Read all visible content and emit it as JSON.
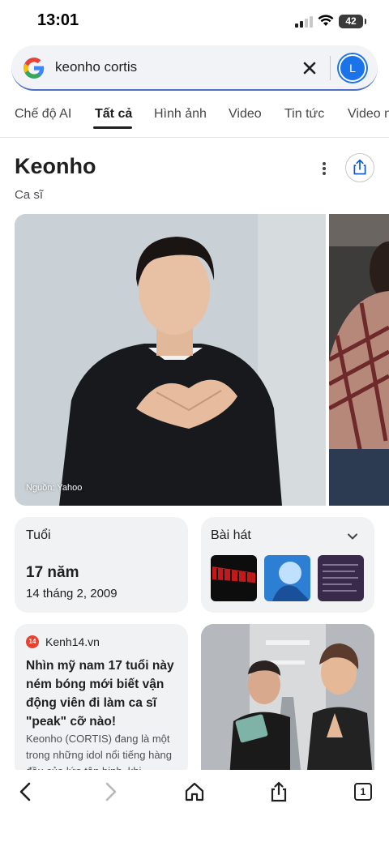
{
  "status": {
    "time": "13:01",
    "battery": "42"
  },
  "search": {
    "query": "keonho cortis",
    "avatar_letter": "L"
  },
  "tabs": [
    {
      "label": "Chế độ AI",
      "active": false
    },
    {
      "label": "Tất cả",
      "active": true
    },
    {
      "label": "Hình ảnh",
      "active": false
    },
    {
      "label": "Video",
      "active": false
    },
    {
      "label": "Tin tức",
      "active": false
    },
    {
      "label": "Video n",
      "active": false
    }
  ],
  "entity": {
    "title": "Keonho",
    "subtitle": "Ca sĩ",
    "photo_caption": "Nguồn: Yahoo"
  },
  "age_card": {
    "label": "Tuổi",
    "value": "17 năm",
    "date": "14 tháng 2, 2009"
  },
  "songs_card": {
    "label": "Bài hát"
  },
  "news": {
    "source": "Kenh14.vn",
    "source_icon_text": "14",
    "title": "Nhìn mỹ nam 17 tuổi này ném bóng mới biết vận động viên đi làm ca sĩ \"peak\" cỡ nào!",
    "snippet": "Keonho (CORTIS) đang là một trong những idol nổi tiếng hàng đầu của lứa tân binh, khi"
  },
  "toolbar": {
    "tab_count": "1"
  },
  "colors": {
    "accent": "#1a73e8",
    "card_bg": "#f0f2f4",
    "search_underline": "#4f6fcb"
  }
}
